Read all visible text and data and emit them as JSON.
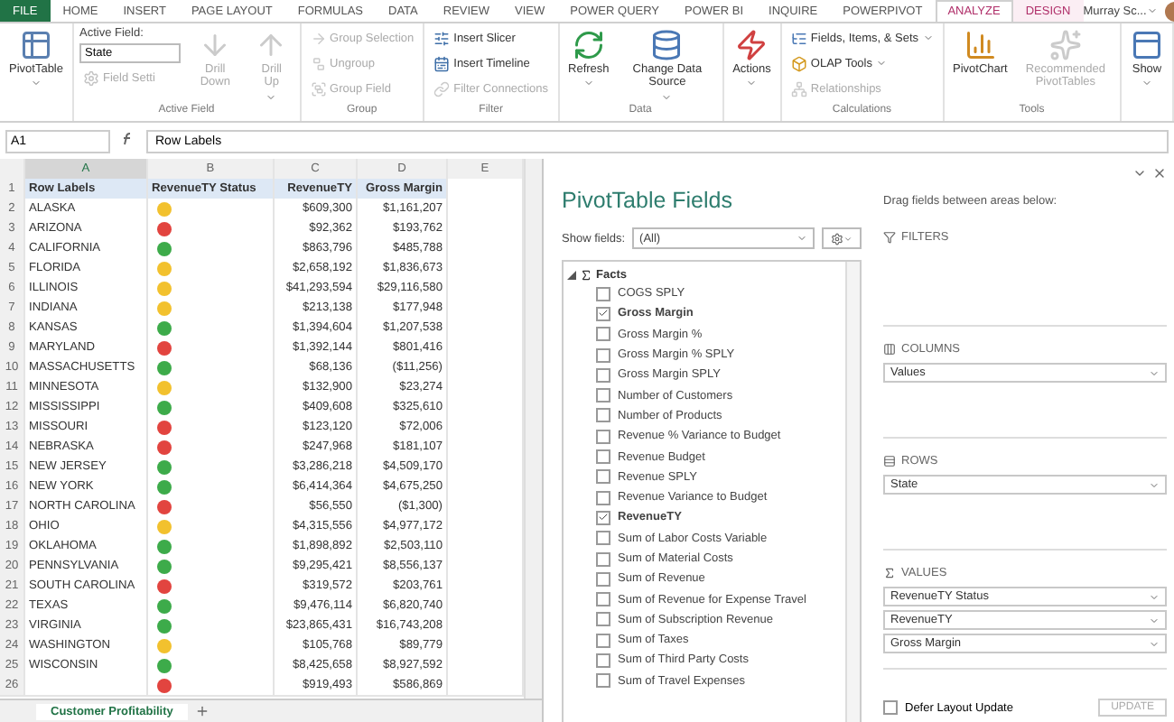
{
  "ribbon_tabs": [
    {
      "label": "FILE",
      "kind": "file",
      "selected": false
    },
    {
      "label": "HOME",
      "kind": "tab",
      "selected": false
    },
    {
      "label": "INSERT",
      "kind": "tab",
      "selected": false
    },
    {
      "label": "PAGE LAYOUT",
      "kind": "tab",
      "selected": false
    },
    {
      "label": "FORMULAS",
      "kind": "tab",
      "selected": false
    },
    {
      "label": "DATA",
      "kind": "tab",
      "selected": false
    },
    {
      "label": "REVIEW",
      "kind": "tab",
      "selected": false
    },
    {
      "label": "VIEW",
      "kind": "tab",
      "selected": false
    },
    {
      "label": "POWER QUERY",
      "kind": "tab",
      "selected": false
    },
    {
      "label": "POWER BI",
      "kind": "tab",
      "selected": false
    },
    {
      "label": "INQUIRE",
      "kind": "tab",
      "selected": false
    },
    {
      "label": "POWERPIVOT",
      "kind": "tab",
      "selected": false
    },
    {
      "label": "ANALYZE",
      "kind": "contextual",
      "selected": true
    },
    {
      "label": "DESIGN",
      "kind": "contextual",
      "selected": false
    }
  ],
  "user": {
    "name": "Murray Sc..."
  },
  "ribbon_groups": [
    {
      "columns": [
        [
          {
            "kind": "large",
            "label": "PivotTable",
            "dropdown": true,
            "disabled": false
          }
        ]
      ]
    },
    {
      "label": "Active Field",
      "columns": [
        [
          {
            "kind": "caption",
            "label": "Active Field:"
          },
          {
            "kind": "field",
            "value": "State"
          },
          {
            "kind": "small",
            "label": "Field Setti",
            "disabled": true
          }
        ],
        [
          {
            "kind": "large",
            "label": "Drill Down",
            "disabled": true,
            "dropdown": false
          }
        ],
        [
          {
            "kind": "large",
            "label": "Drill Up",
            "disabled": true,
            "dropdown": true
          }
        ]
      ]
    },
    {
      "label": "Group",
      "columns": [
        [
          {
            "kind": "small",
            "label": "Group Selection",
            "disabled": true
          },
          {
            "kind": "small",
            "label": "Ungroup",
            "disabled": true
          },
          {
            "kind": "small",
            "label": "Group Field",
            "disabled": true
          }
        ]
      ]
    },
    {
      "label": "Filter",
      "columns": [
        [
          {
            "kind": "small",
            "label": "Insert Slicer",
            "disabled": false
          },
          {
            "kind": "small",
            "label": "Insert Timeline",
            "disabled": false
          },
          {
            "kind": "small",
            "label": "Filter Connections",
            "disabled": true
          }
        ]
      ]
    },
    {
      "label": "Data",
      "columns": [
        [
          {
            "kind": "large",
            "label": "Refresh",
            "dropdown": true,
            "disabled": false
          }
        ],
        [
          {
            "kind": "large",
            "label": "Change Data Source",
            "dropdown": true,
            "disabled": false
          }
        ]
      ]
    },
    {
      "columns": [
        [
          {
            "kind": "large",
            "label": "Actions",
            "dropdown": true,
            "disabled": false
          }
        ]
      ]
    },
    {
      "label": "Calculations",
      "columns": [
        [
          {
            "kind": "small",
            "label": "Fields, Items, & Sets",
            "dropdown": true,
            "disabled": false
          },
          {
            "kind": "small",
            "label": "OLAP Tools",
            "dropdown": true,
            "disabled": false
          },
          {
            "kind": "small",
            "label": "Relationships",
            "disabled": true
          }
        ]
      ]
    },
    {
      "label": "Tools",
      "columns": [
        [
          {
            "kind": "large",
            "label": "PivotChart",
            "dropdown": false,
            "disabled": false
          }
        ],
        [
          {
            "kind": "large",
            "label": "Recommended PivotTables",
            "dropdown": false,
            "disabled": true
          }
        ]
      ]
    },
    {
      "columns": [
        [
          {
            "kind": "large",
            "label": "Show",
            "dropdown": true,
            "disabled": false
          }
        ]
      ]
    }
  ],
  "formula_bar": {
    "name_box": "A1",
    "formula": "Row Labels"
  },
  "sheet": {
    "columns": [
      "A",
      "B",
      "C",
      "D",
      "E"
    ],
    "header": {
      "row": "1",
      "cells": [
        "Row Labels",
        "RevenueTY Status",
        "RevenueTY",
        "Gross Margin"
      ]
    },
    "rows": [
      {
        "row": "2",
        "state": "ALASKA",
        "color": "#f2c12e",
        "revenue": "$609,300",
        "margin": "$1,161,207"
      },
      {
        "row": "3",
        "state": "ARIZONA",
        "color": "#e2443f",
        "revenue": "$92,362",
        "margin": "$193,762"
      },
      {
        "row": "4",
        "state": "CALIFORNIA",
        "color": "#3dab4a",
        "revenue": "$863,796",
        "margin": "$485,788"
      },
      {
        "row": "5",
        "state": "FLORIDA",
        "color": "#f2c12e",
        "revenue": "$2,658,192",
        "margin": "$1,836,673"
      },
      {
        "row": "6",
        "state": "ILLINOIS",
        "color": "#f2c12e",
        "revenue": "$41,293,594",
        "margin": "$29,116,580"
      },
      {
        "row": "7",
        "state": "INDIANA",
        "color": "#f2c12e",
        "revenue": "$213,138",
        "margin": "$177,948"
      },
      {
        "row": "8",
        "state": "KANSAS",
        "color": "#3dab4a",
        "revenue": "$1,394,604",
        "margin": "$1,207,538"
      },
      {
        "row": "9",
        "state": "MARYLAND",
        "color": "#e2443f",
        "revenue": "$1,392,144",
        "margin": "$801,416"
      },
      {
        "row": "10",
        "state": "MASSACHUSETTS",
        "color": "#3dab4a",
        "revenue": "$68,136",
        "margin": "($11,256)"
      },
      {
        "row": "11",
        "state": "MINNESOTA",
        "color": "#f2c12e",
        "revenue": "$132,900",
        "margin": "$23,274"
      },
      {
        "row": "12",
        "state": "MISSISSIPPI",
        "color": "#3dab4a",
        "revenue": "$409,608",
        "margin": "$325,610"
      },
      {
        "row": "13",
        "state": "MISSOURI",
        "color": "#e2443f",
        "revenue": "$123,120",
        "margin": "$72,006"
      },
      {
        "row": "14",
        "state": "NEBRASKA",
        "color": "#e2443f",
        "revenue": "$247,968",
        "margin": "$181,107"
      },
      {
        "row": "15",
        "state": "NEW JERSEY",
        "color": "#3dab4a",
        "revenue": "$3,286,218",
        "margin": "$4,509,170"
      },
      {
        "row": "16",
        "state": "NEW YORK",
        "color": "#3dab4a",
        "revenue": "$6,414,364",
        "margin": "$4,675,250"
      },
      {
        "row": "17",
        "state": "NORTH CAROLINA",
        "color": "#e2443f",
        "revenue": "$56,550",
        "margin": "($1,300)"
      },
      {
        "row": "18",
        "state": "OHIO",
        "color": "#f2c12e",
        "revenue": "$4,315,556",
        "margin": "$4,977,172"
      },
      {
        "row": "19",
        "state": "OKLAHOMA",
        "color": "#3dab4a",
        "revenue": "$1,898,892",
        "margin": "$2,503,110"
      },
      {
        "row": "20",
        "state": "PENNSYLVANIA",
        "color": "#3dab4a",
        "revenue": "$9,295,421",
        "margin": "$8,556,137"
      },
      {
        "row": "21",
        "state": "SOUTH CAROLINA",
        "color": "#e2443f",
        "revenue": "$319,572",
        "margin": "$203,761"
      },
      {
        "row": "22",
        "state": "TEXAS",
        "color": "#3dab4a",
        "revenue": "$9,476,114",
        "margin": "$6,820,740"
      },
      {
        "row": "23",
        "state": "VIRGINIA",
        "color": "#3dab4a",
        "revenue": "$23,865,431",
        "margin": "$16,743,208"
      },
      {
        "row": "24",
        "state": "WASHINGTON",
        "color": "#f2c12e",
        "revenue": "$105,768",
        "margin": "$89,779"
      },
      {
        "row": "25",
        "state": "WISCONSIN",
        "color": "#3dab4a",
        "revenue": "$8,425,658",
        "margin": "$8,927,592"
      },
      {
        "row": "26",
        "color": "#e2443f",
        "revenue": "$919,493",
        "margin": "$586,869"
      }
    ],
    "sheet_tabs": [
      {
        "label": "Customer Profitability",
        "selected": true
      }
    ]
  },
  "pivot_fields": {
    "title": "PivotTable Fields",
    "show_fields_label": "Show fields:",
    "show_fields_value": "(All)",
    "groups": [
      {
        "label": "Facts",
        "expanded": true,
        "children": [
          {
            "label": "COGS SPLY",
            "checked": false
          },
          {
            "label": "Gross Margin",
            "checked": true
          },
          {
            "label": "Gross Margin %",
            "checked": false
          },
          {
            "label": "Gross Margin % SPLY",
            "checked": false
          },
          {
            "label": "Gross Margin SPLY",
            "checked": false
          },
          {
            "label": "Number of Customers",
            "checked": false
          },
          {
            "label": "Number of Products",
            "checked": false
          },
          {
            "label": "Revenue % Variance to Budget",
            "checked": false
          },
          {
            "label": "Revenue Budget",
            "checked": false
          },
          {
            "label": "Revenue SPLY",
            "checked": false
          },
          {
            "label": "Revenue Variance to Budget",
            "checked": false
          },
          {
            "label": "RevenueTY",
            "checked": true
          },
          {
            "label": "Sum of Labor Costs Variable",
            "checked": false
          },
          {
            "label": "Sum of Material Costs",
            "checked": false
          },
          {
            "label": "Sum of Revenue",
            "checked": false
          },
          {
            "label": "Sum of Revenue for Expense Travel",
            "checked": false
          },
          {
            "label": "Sum of Subscription Revenue",
            "checked": false
          },
          {
            "label": "Sum of Taxes",
            "checked": false
          },
          {
            "label": "Sum of Third Party Costs",
            "checked": false
          },
          {
            "label": "Sum of Travel Expenses",
            "checked": false
          }
        ]
      }
    ],
    "hint": "Drag fields between areas below:",
    "areas": [
      {
        "kind": "filters",
        "label": "FILTERS"
      },
      {
        "kind": "columns",
        "label": "COLUMNS",
        "items": [
          "Values"
        ]
      },
      {
        "kind": "rows",
        "label": "ROWS",
        "items": [
          "State"
        ]
      },
      {
        "kind": "values",
        "label": "VALUES",
        "items": [
          "RevenueTY Status",
          "RevenueTY",
          "Gross Margin"
        ]
      }
    ],
    "defer_update": {
      "label": "Defer Layout Update",
      "checked": false
    },
    "update_button": {
      "label": "UPDATE",
      "disabled": true
    }
  }
}
